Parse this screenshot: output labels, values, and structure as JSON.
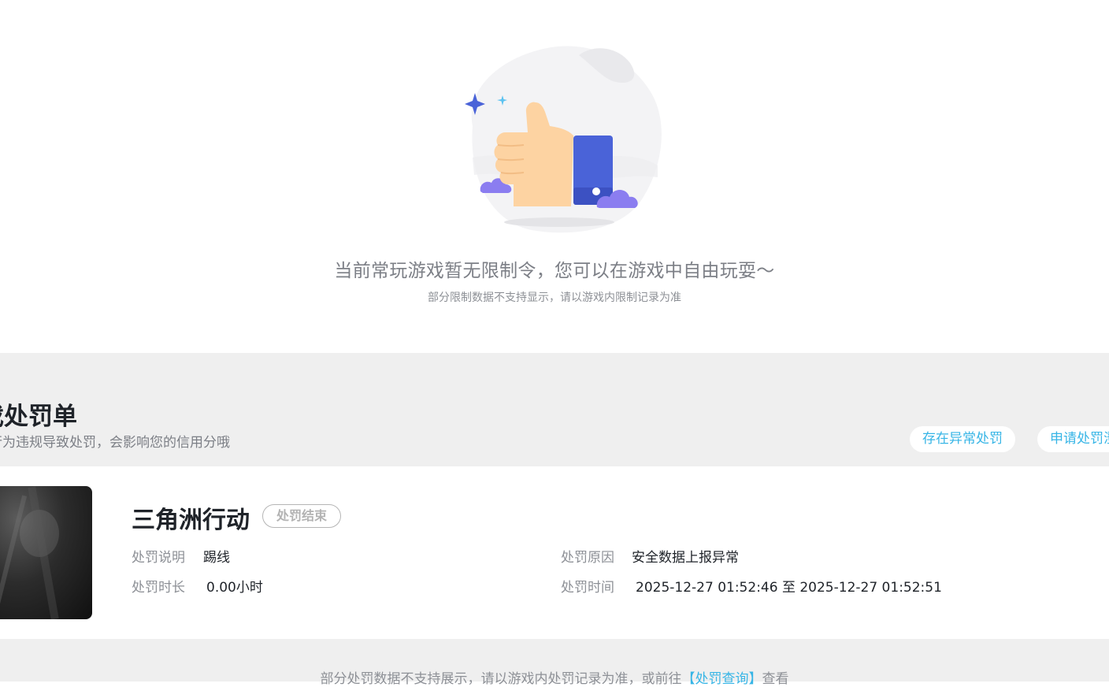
{
  "empty_state": {
    "title": "当前常玩游戏暂无限制令，您可以在游戏中自由玩耍～",
    "subtitle": "部分限制数据不支持显示，请以游戏内限制记录为准"
  },
  "penalty_section": {
    "title": "戏处罚单",
    "subtitle": "行为违规导致处罚，会影响您的信用分哦",
    "buttons": [
      "存在异常处罚",
      "申请处罚澄"
    ]
  },
  "penalty_card": {
    "game_name": "三角洲行动",
    "status": "处罚结束",
    "fields": {
      "desc_label": "处罚说明",
      "desc_value": "踢线",
      "reason_label": "处罚原因",
      "reason_value": "安全数据上报异常",
      "duration_label": "处罚时长",
      "duration_value": "0.00小时",
      "time_label": "处罚时间",
      "time_value": "2025-12-27 01:52:46 至 2025-12-27 01:52:51"
    }
  },
  "footer": {
    "prefix": "部分处罚数据不支持展示，请以游戏内处罚记录为准，或前往",
    "link": "【处罚查询】",
    "suffix": "查看"
  },
  "colors": {
    "accent": "#37b5e6",
    "band": "#efefef",
    "thumb_blue": "#4a63d8",
    "cloud_purple": "#8b7df0"
  }
}
